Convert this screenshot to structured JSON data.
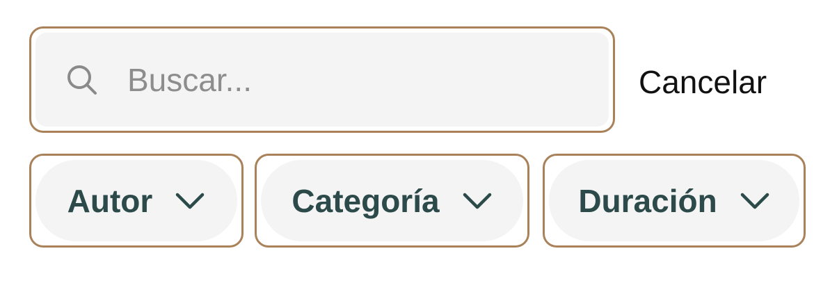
{
  "search": {
    "placeholder": "Buscar...",
    "value": "",
    "cancel_label": "Cancelar"
  },
  "filters": [
    {
      "label": "Autor",
      "icon": "chevron-down-icon"
    },
    {
      "label": "Categoría",
      "icon": "chevron-down-icon"
    },
    {
      "label": "Duración",
      "icon": "chevron-down-icon"
    }
  ],
  "colors": {
    "border": "#a9825a",
    "field_bg": "#f4f4f4",
    "chip_text": "#2c4a49",
    "placeholder": "#8d8d8d"
  }
}
